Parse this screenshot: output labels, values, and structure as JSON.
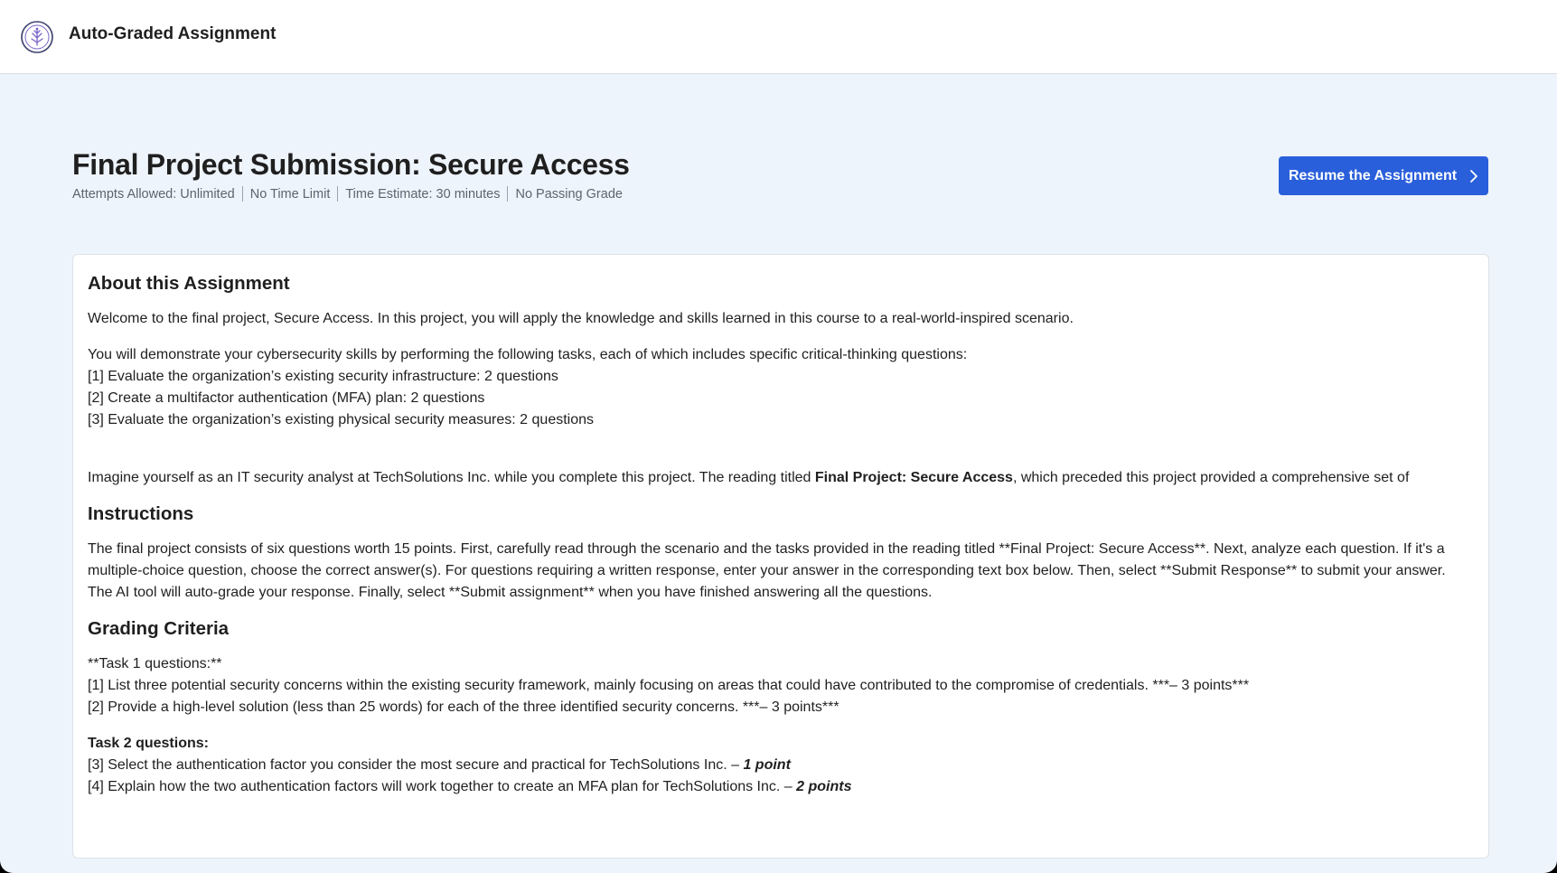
{
  "app": {
    "title": "Auto-Graded Assignment"
  },
  "assignment": {
    "title": "Final Project Submission: Secure Access",
    "meta": [
      "Attempts Allowed: Unlimited",
      "No Time Limit",
      "Time Estimate: 30 minutes",
      "No Passing Grade"
    ],
    "resume_label": "Resume the Assignment"
  },
  "about": {
    "heading": "About this Assignment",
    "welcome": "Welcome to the final project, Secure Access. In this project, you will apply the knowledge and skills learned in this course to a real-world-inspired scenario.",
    "tasks_intro": "You will demonstrate your cybersecurity skills by performing the following tasks, each of which includes specific critical-thinking questions:",
    "tasks": [
      "[1] Evaluate the organization’s existing security infrastructure: 2 questions",
      "[2] Create a multifactor authentication (MFA) plan: 2 questions",
      "[3] Evaluate the organization’s existing physical security measures: 2 questions"
    ],
    "imagine_before": "Imagine yourself as an IT security analyst at TechSolutions Inc. while you complete this project. The reading titled ",
    "imagine_bold": "Final Project: Secure Access",
    "imagine_after": ", which preceded this project provided a comprehensive set of"
  },
  "instructions": {
    "heading": "Instructions",
    "text": "The final project consists of six questions worth 15 points. First, carefully read through the scenario and the tasks provided in the reading titled **Final Project: Secure Access**. Next, analyze each question. If it's a multiple-choice question, choose the correct answer(s). For questions requiring a written response, enter your answer in the corresponding text box below. Then, select **Submit Response** to submit your answer. The AI tool will auto-grade your response. Finally, select **Submit assignment** when you have finished answering all the questions."
  },
  "grading": {
    "heading": "Grading Criteria",
    "task1_heading": "**Task 1 questions:**",
    "task1_items": [
      "[1] List three potential security concerns within the existing security framework, mainly focusing on areas that could have contributed to the compromise of credentials. ***– 3 points***",
      "[2] Provide a high-level solution (less than 25 words) for each of the three identified security concerns. ***– 3 points***"
    ],
    "task2_heading": "Task 2 questions:",
    "task2_items": [
      {
        "text": "[3] Select the authentication factor you consider the most secure and practical for TechSolutions Inc. – ",
        "points": "1 point"
      },
      {
        "text": "[4] Explain how the two authentication factors will work together to create an MFA plan for TechSolutions Inc. – ",
        "points": "2 points"
      }
    ]
  },
  "colors": {
    "accent": "#2a5fdb",
    "page_bg": "#eef4fb",
    "text": "#1f1f1f",
    "muted": "#5b6570"
  }
}
